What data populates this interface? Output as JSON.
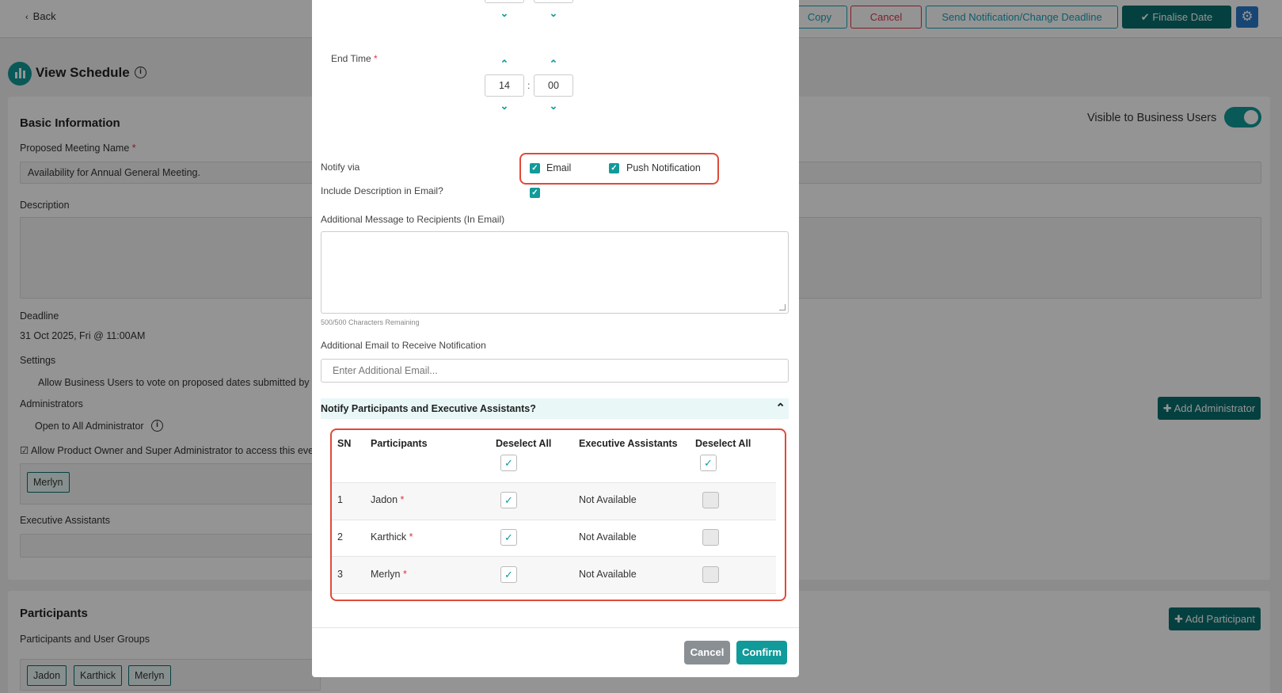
{
  "topbar": {
    "back_label": "Back",
    "copy_label": "Copy",
    "cancel_label": "Cancel",
    "notify_label": "Send Notification/Change Deadline",
    "finalise_label": "Finalise Date"
  },
  "page": {
    "title": "View Schedule",
    "basic_info_heading": "Basic Information",
    "visible_label": "Visible to Business Users",
    "meeting_name_label": "Proposed Meeting Name",
    "meeting_name_value": "Availability for Annual General Meeting.",
    "description_label": "Description",
    "deadline_label": "Deadline",
    "deadline_value": "31 Oct 2025, Fri @ 11:00AM",
    "settings_label": "Settings",
    "settings_value": "Allow Business Users to vote on proposed dates submitted by o",
    "administrators_label": "Administrators",
    "open_all_admin_label": "Open to All Administrator",
    "allow_owner_label": "Allow Product Owner and Super Administrator to access this eve",
    "admin_chip": "Merlyn",
    "add_admin_label": "Add Administrator",
    "exec_assistants_label": "Executive Assistants",
    "participants_heading": "Participants",
    "participants_groups_label": "Participants and User Groups",
    "participant_chips": [
      "Jadon",
      "Karthick",
      "Merlyn"
    ],
    "add_participant_label": "Add Participant"
  },
  "modal": {
    "time_top": {
      "hour": "",
      "minute": ""
    },
    "end_time_label": "End Time",
    "end_time": {
      "hour": "14",
      "minute": "00"
    },
    "notify_via_label": "Notify via",
    "email_option": "Email",
    "push_option": "Push Notification",
    "include_desc_label": "Include Description in Email?",
    "additional_msg_label": "Additional Message to Recipients (In Email)",
    "chars_remaining": "500/500 Characters Remaining",
    "additional_email_label": "Additional Email to Receive Notification",
    "additional_email_placeholder": "Enter Additional Email...",
    "notify_participants_heading": "Notify Participants and Executive Assistants?",
    "table": {
      "headers": {
        "sn": "SN",
        "participants": "Participants",
        "deselect_all_1": "Deselect All",
        "exec_assistants": "Executive Assistants",
        "deselect_all_2": "Deselect All"
      },
      "rows": [
        {
          "sn": "1",
          "name": "Jadon",
          "ea": "Not Available"
        },
        {
          "sn": "2",
          "name": "Karthick",
          "ea": "Not Available"
        },
        {
          "sn": "3",
          "name": "Merlyn",
          "ea": "Not Available"
        }
      ]
    },
    "cancel_label": "Cancel",
    "confirm_label": "Confirm"
  },
  "colors": {
    "accent": "#119a9a",
    "dark_accent": "#0a6e6e",
    "danger": "#dc3545",
    "highlight_box": "#e04a3a"
  }
}
